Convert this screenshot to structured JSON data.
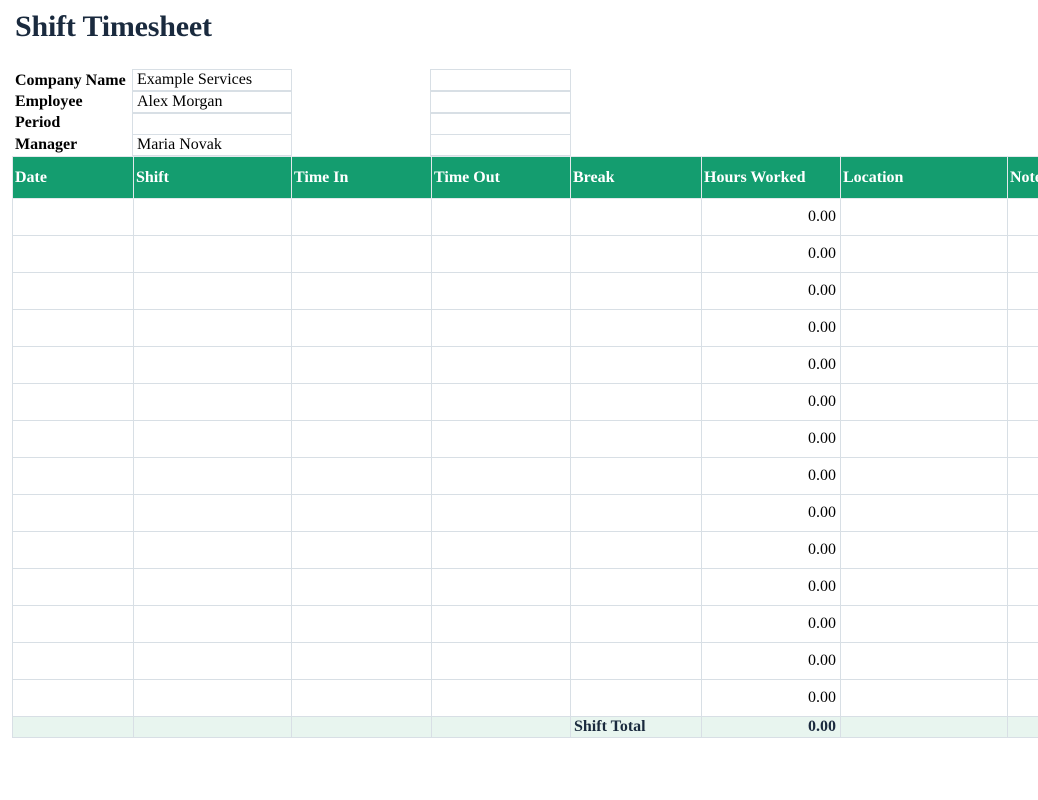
{
  "title": "Shift Timesheet",
  "info": {
    "company_label": "Company Name",
    "company_value": "Example Services",
    "employee_label": "Employee",
    "employee_value": "Alex Morgan",
    "period_label": "Period",
    "period_value": "",
    "manager_label": "Manager",
    "manager_value": "Maria Novak"
  },
  "columns": [
    "Date",
    "Shift",
    "Time In",
    "Time Out",
    "Break",
    "Hours Worked",
    "Location",
    "Notes"
  ],
  "rows": [
    [
      "",
      "",
      "",
      "",
      "",
      "0.00",
      "",
      ""
    ],
    [
      "",
      "",
      "",
      "",
      "",
      "0.00",
      "",
      ""
    ],
    [
      "",
      "",
      "",
      "",
      "",
      "0.00",
      "",
      ""
    ],
    [
      "",
      "",
      "",
      "",
      "",
      "0.00",
      "",
      ""
    ],
    [
      "",
      "",
      "",
      "",
      "",
      "0.00",
      "",
      ""
    ],
    [
      "",
      "",
      "",
      "",
      "",
      "0.00",
      "",
      ""
    ],
    [
      "",
      "",
      "",
      "",
      "",
      "0.00",
      "",
      ""
    ],
    [
      "",
      "",
      "",
      "",
      "",
      "0.00",
      "",
      ""
    ],
    [
      "",
      "",
      "",
      "",
      "",
      "0.00",
      "",
      ""
    ],
    [
      "",
      "",
      "",
      "",
      "",
      "0.00",
      "",
      ""
    ],
    [
      "",
      "",
      "",
      "",
      "",
      "0.00",
      "",
      ""
    ],
    [
      "",
      "",
      "",
      "",
      "",
      "0.00",
      "",
      ""
    ],
    [
      "",
      "",
      "",
      "",
      "",
      "0.00",
      "",
      ""
    ],
    [
      "",
      "",
      "",
      "",
      "",
      "0.00",
      "",
      ""
    ]
  ],
  "total": {
    "label": "Shift Total",
    "value": "0.00"
  },
  "colors": {
    "header_bg": "#149d6f",
    "total_bg": "#e8f5ef",
    "title": "#1a2a3e"
  }
}
